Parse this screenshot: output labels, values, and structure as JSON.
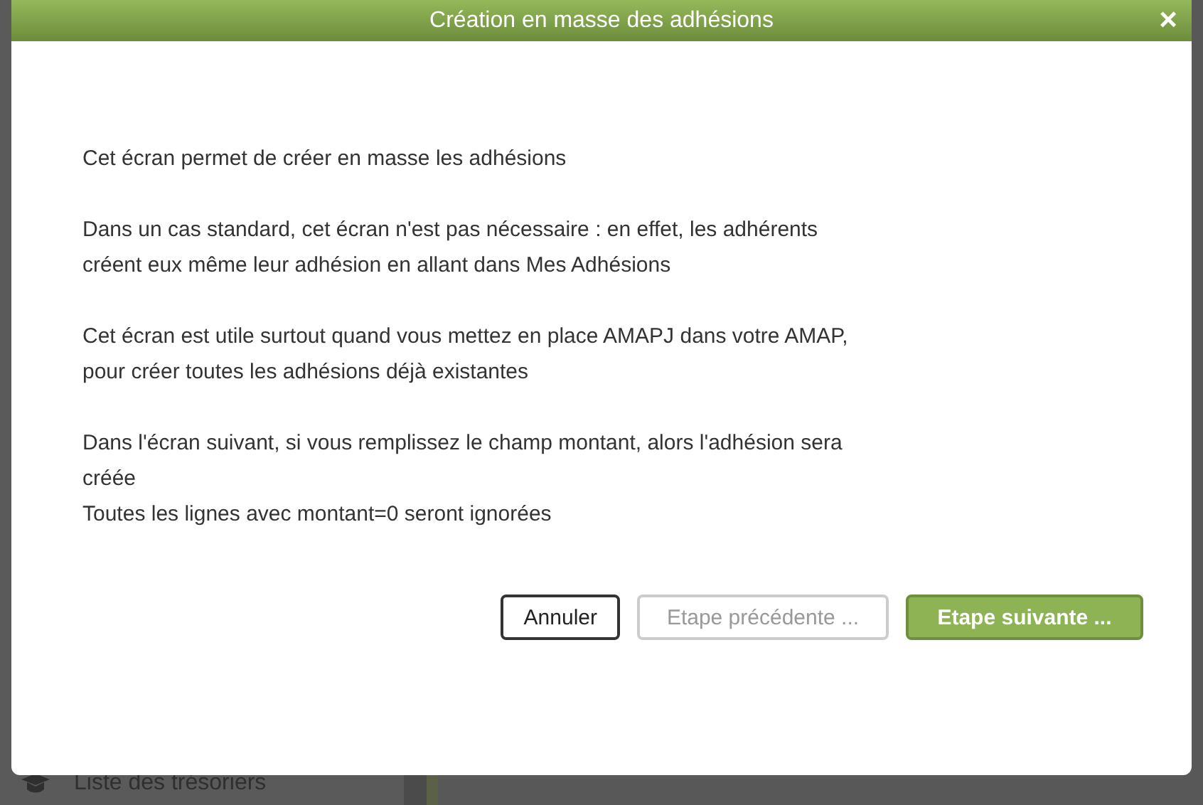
{
  "background": {
    "sidebar_item": {
      "label": "Liste des trésoriers"
    }
  },
  "dialog": {
    "title": "Création en masse des adhésions",
    "close": "×",
    "paragraphs": [
      [
        "Cet écran permet de créer en masse les adhésions"
      ],
      [
        "Dans un cas standard, cet écran n'est pas nécessaire : en effet, les adhérents",
        "créent eux même leur adhésion en allant dans Mes Adhésions"
      ],
      [
        "Cet écran est utile surtout quand vous mettez en place AMAPJ dans votre AMAP,",
        "pour créer toutes les adhésions déjà existantes"
      ],
      [
        "Dans l'écran suivant, si vous remplissez le champ montant, alors l'adhésion sera",
        "créée",
        "Toutes les lignes avec montant=0 seront ignorées"
      ]
    ],
    "buttons": [
      {
        "label": "Annuler",
        "kind": "plain",
        "disabled": false
      },
      {
        "label": "Etape précédente ...",
        "kind": "plain",
        "disabled": true
      },
      {
        "label": "Etape suivante ...",
        "kind": "primary",
        "disabled": false
      }
    ]
  }
}
